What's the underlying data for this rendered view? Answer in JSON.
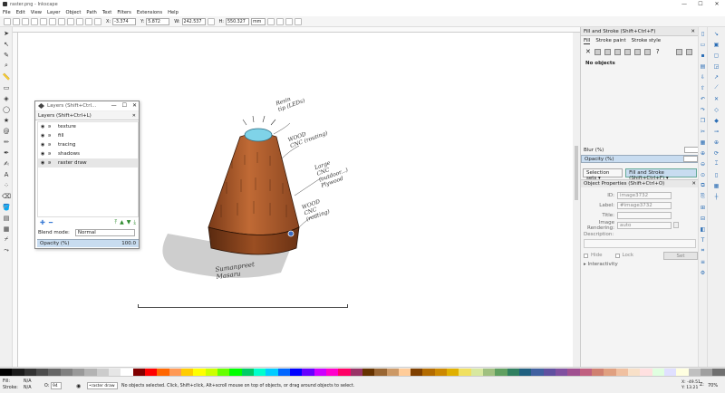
{
  "window": {
    "title": "raster.png - Inkscape",
    "min": "—",
    "max": "☐",
    "close": "✕"
  },
  "menu": [
    "File",
    "Edit",
    "View",
    "Layer",
    "Object",
    "Path",
    "Text",
    "Filters",
    "Extensions",
    "Help"
  ],
  "toolctl": {
    "x_label": "X:",
    "x_value": "-3.374",
    "y_label": "Y:",
    "y_value": "5.872",
    "w_label": "W:",
    "w_value": "242.537",
    "h_label": "H:",
    "h_value": "550.327",
    "unit": "mm"
  },
  "layers_dialog": {
    "title": "Layers (Shift+Ctrl...",
    "tab": "Layers (Shift+Ctrl+L)",
    "layers": [
      {
        "name": "texture"
      },
      {
        "name": "fill"
      },
      {
        "name": "tracing"
      },
      {
        "name": "shadows"
      },
      {
        "name": "raster draw"
      }
    ],
    "blend_label": "Blend mode:",
    "blend_value": "Normal",
    "opacity_label": "Opacity (%)",
    "opacity_value": "100.0"
  },
  "fill_stroke": {
    "header": "Fill and Stroke (Shift+Ctrl+F)",
    "tabs": [
      "Fill",
      "Stroke paint",
      "Stroke style"
    ],
    "no_objects": "No objects",
    "blur_label": "Blur (%)",
    "opacity_label": "Opacity (%)"
  },
  "panel_tabs": [
    "Selection sets ▾",
    "Fill and Stroke (Shift+Ctrl+F) ▾"
  ],
  "object_properties": {
    "header": "Object Properties (Shift+Ctrl+O)",
    "fields": [
      {
        "label": "ID:",
        "value": "image3732"
      },
      {
        "label": "Label:",
        "value": "#image3732"
      },
      {
        "label": "Title:",
        "value": ""
      },
      {
        "label": "Image Rendering:",
        "value": "auto"
      }
    ],
    "description_label": "Description:",
    "hide_label": "Hide",
    "lock_label": "Lock",
    "set_label": "Set",
    "interactivity_label": "Interactivity"
  },
  "status": {
    "fill_label": "Fill:",
    "fill_value": "N/A",
    "stroke_label": "Stroke:",
    "stroke_value": "N/A",
    "o_label": "O:",
    "o_value": "94",
    "layer_value": "•raster draw",
    "message": "No objects selected. Click, Shift+click, Alt+scroll mouse on top of objects, or drag around objects to select.",
    "x_label": "X:",
    "x_value": "-49.51",
    "y_label": "Y:",
    "y_value": "13.21",
    "z_label": "Z:",
    "zoom_value": "70%"
  },
  "sketch_notes": {
    "n1": "Resin\ntip (LEDs)",
    "n2": "WOOD\nCNC (routing)",
    "n3": "Large\nCNC\n(outdoor...)\nPlywood",
    "n4": "WOOD\nCNC\n(routing)",
    "signature": "Sumanpreet\nMasaru"
  },
  "icons": {
    "select": "arrow-select-icon",
    "node": "node-icon",
    "zoom": "zoom-icon"
  },
  "palette": [
    "#000000",
    "#1a1a1a",
    "#333333",
    "#4d4d4d",
    "#666666",
    "#808080",
    "#999999",
    "#b3b3b3",
    "#cccccc",
    "#e6e6e6",
    "#ffffff",
    "#800000",
    "#ff0000",
    "#ff6600",
    "#ff9955",
    "#ffcc00",
    "#ffff00",
    "#ccff00",
    "#66ff00",
    "#00ff00",
    "#00cc66",
    "#00ffcc",
    "#00ccff",
    "#0066ff",
    "#0000ff",
    "#6600ff",
    "#cc00ff",
    "#ff00cc",
    "#ff0066",
    "#993366",
    "#663300",
    "#996633",
    "#cc9966",
    "#ffcc99",
    "#804000",
    "#b36b00",
    "#cc8800",
    "#e0b000",
    "#f0e060",
    "#d8e8a0",
    "#a0c080",
    "#60a060",
    "#308060",
    "#206080",
    "#4060a0",
    "#6050a0",
    "#8050a0",
    "#a05090",
    "#c06080",
    "#d08070",
    "#e0a080",
    "#f0c0a0",
    "#f8e0c8",
    "#ffe0e0",
    "#e0ffe0",
    "#e0e0ff",
    "#ffffe0",
    "#c0c0c0",
    "#a0a0a0",
    "#707070"
  ]
}
